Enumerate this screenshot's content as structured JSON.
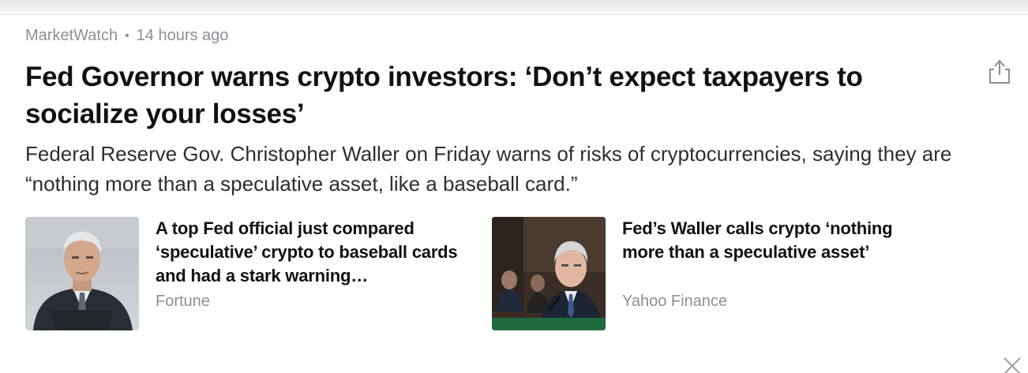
{
  "article": {
    "source": "MarketWatch",
    "separator": "•",
    "time": "14 hours ago",
    "headline": "Fed Governor warns crypto investors: ‘Don’t expect taxpayers to socialize your losses’",
    "summary": "Federal Reserve Gov. Christopher Waller on Friday warns of risks of cryptocurrencies, saying they are “nothing more than a speculative asset, like a baseball card.”"
  },
  "related": [
    {
      "title": "A top Fed official just compared ‘speculative’ crypto to baseball cards and had a stark warning…",
      "source": "Fortune"
    },
    {
      "title": "Fed’s Waller calls crypto ‘nothing more than a speculative asset’",
      "source": "Yahoo Finance"
    }
  ],
  "icons": {
    "share": "share-icon",
    "close": "close-icon"
  },
  "colors": {
    "headline": "#101114",
    "meta": "#8a8f96",
    "summary": "#2b2f33"
  }
}
